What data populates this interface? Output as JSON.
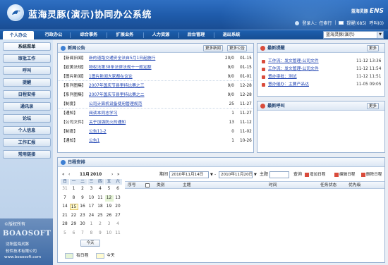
{
  "header": {
    "title": "蓝海灵豚(演示)协同办公系统",
    "brand_small": "蓝海灵豚",
    "brand_large": "ENS",
    "user_label": "登录人：任索行",
    "mail_label": "提醒(685)",
    "call_label": "呼叫(0)"
  },
  "nav": {
    "tabs": [
      "个人办公",
      "行政办公",
      "综合事务",
      "扩展业务",
      "人力资源",
      "后台管理",
      "退出系统"
    ],
    "select_value": "蓝海灵豚(演示)"
  },
  "sidebar": {
    "items": [
      "系统菜单",
      "审批工作",
      "呼叫",
      "提醒",
      "日程安排",
      "通讯录",
      "论坛",
      "个人信息",
      "工作汇报",
      "常用链接"
    ]
  },
  "copyright": {
    "line1": "©版权所有",
    "line2": "BOAOSOFT",
    "line3": "沈阳蓝海灵豚",
    "line4": "软件技术有限公司",
    "line5": "www.boaosoft.com"
  },
  "news": {
    "title": "新闻公告",
    "more_news": "更多新闻",
    "more_notice": "更多公告",
    "rows": [
      {
        "cat": "【新闻旧闻】",
        "title": "新的道路交通安全法自5月1日起施行",
        "count": "20/0",
        "date": "01-15"
      },
      {
        "cat": "【欧美法规】",
        "title": "物权法第38条法律法规十一般定额",
        "count": "9/0",
        "date": "01-15"
      },
      {
        "cat": "【图片新闻】",
        "title": "1图片新闻大家都在议论",
        "count": "9/0",
        "date": "01-01"
      },
      {
        "cat": "【系列图集】",
        "title": "2007年国庆节县里持比赛之三",
        "count": "9/0",
        "date": "12-28"
      },
      {
        "cat": "【系列图集】",
        "title": "2007年国庆节县里持比赛之二",
        "count": "9/0",
        "date": "12-28"
      },
      {
        "cat": "【制度】",
        "title": "公司计算机设备使用管理规范",
        "count": "25",
        "date": "11-27"
      },
      {
        "cat": "【通知】",
        "title": "阅读本同志学习",
        "count": "1",
        "date": "11-27"
      },
      {
        "cat": "【公司文件】",
        "title": "关于加强防火的通知",
        "count": "13",
        "date": "11-12"
      },
      {
        "cat": "【制度】",
        "title": "公告11-2",
        "count": "0",
        "date": "11-02"
      },
      {
        "cat": "【通知】",
        "title": "公告1",
        "count": "1",
        "date": "10-26"
      }
    ]
  },
  "warnings": {
    "title": "最新提醒",
    "more": "更多",
    "rows": [
      {
        "title": "工作流：发文管理-公司文件",
        "date": "11-12 13:36"
      },
      {
        "title": "工作流：发文管理-公司文件",
        "date": "11-12 11:54"
      },
      {
        "title": "督办审批：测试",
        "date": "11-12 11:51"
      },
      {
        "title": "督办催办：主要产品达",
        "date": "11-05 09:05"
      }
    ]
  },
  "calls": {
    "title": "最新呼叫",
    "more": "更多"
  },
  "schedule": {
    "title": "日程安排",
    "period_label": "期间",
    "date_from": "2010年11月14日",
    "date_to": "2010年11月20日",
    "theme_label": "主题",
    "query_label": "查询",
    "add_label": "增加日程",
    "edit_label": "编辑日程",
    "delete_label": "删除日程",
    "columns": [
      "序号",
      "类别",
      "主题",
      "时间",
      "任务状态",
      "优先级"
    ],
    "legend_has": "有日程",
    "legend_today": "今天",
    "today_button": "今天"
  },
  "calendar": {
    "month_label": "11月",
    "year_label": "2010",
    "nav_prev2": "«",
    "nav_prev": "‹",
    "nav_next": "›",
    "nav_next2": "»",
    "weekdays": [
      "日",
      "一",
      "二",
      "三",
      "四",
      "五",
      "六"
    ],
    "weeks": [
      [
        "31",
        "1",
        "2",
        "3",
        "4",
        "5",
        "6"
      ],
      [
        "7",
        "8",
        "9",
        "10",
        "11",
        "12",
        "13"
      ],
      [
        "14",
        "15",
        "16",
        "17",
        "18",
        "19",
        "20"
      ],
      [
        "21",
        "22",
        "23",
        "24",
        "25",
        "26",
        "27"
      ],
      [
        "28",
        "29",
        "30",
        "1",
        "2",
        "3",
        "4"
      ],
      [
        "5",
        "6",
        "7",
        "8",
        "9",
        "10",
        "11"
      ]
    ]
  },
  "colors": {
    "header": "#1e5aa9",
    "link": "#1a3fb0",
    "today": "#fffbd0",
    "has_schedule": "#e5f4d6"
  }
}
